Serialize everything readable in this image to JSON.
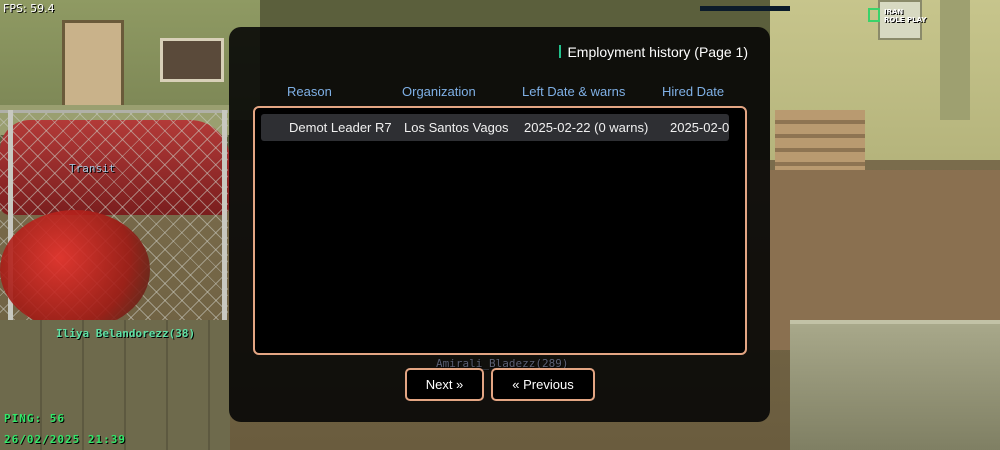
{
  "hud": {
    "fps": "FPS: 59.4",
    "ping": "PING: 56",
    "datetime": "26/02/2025 21:39"
  },
  "server_logo": {
    "line1": "IRAN",
    "line2": "ROLE PLAY",
    "accent": "#3ad26a"
  },
  "nametags": {
    "player": "Iliya Belandorezz(38)",
    "vehicle": "Transit",
    "behind_dialog": "Amirali_Bladezz(289)"
  },
  "dialog": {
    "title": "Employment history (Page 1)",
    "columns": [
      "Reason",
      "Organization",
      "Left Date & warns",
      "Hired Date"
    ],
    "rows": [
      [
        "Demot Leader R7",
        "Los Santos Vagos",
        "2025-02-22 (0 warns)",
        "2025-02-0"
      ]
    ],
    "buttons": {
      "next": "Next »",
      "previous": "« Previous"
    },
    "colors": {
      "header_text": "#7fb0e6",
      "border": "#e3a583",
      "title_accent": "#21c08b",
      "row_highlight": "#2e2f33"
    }
  }
}
